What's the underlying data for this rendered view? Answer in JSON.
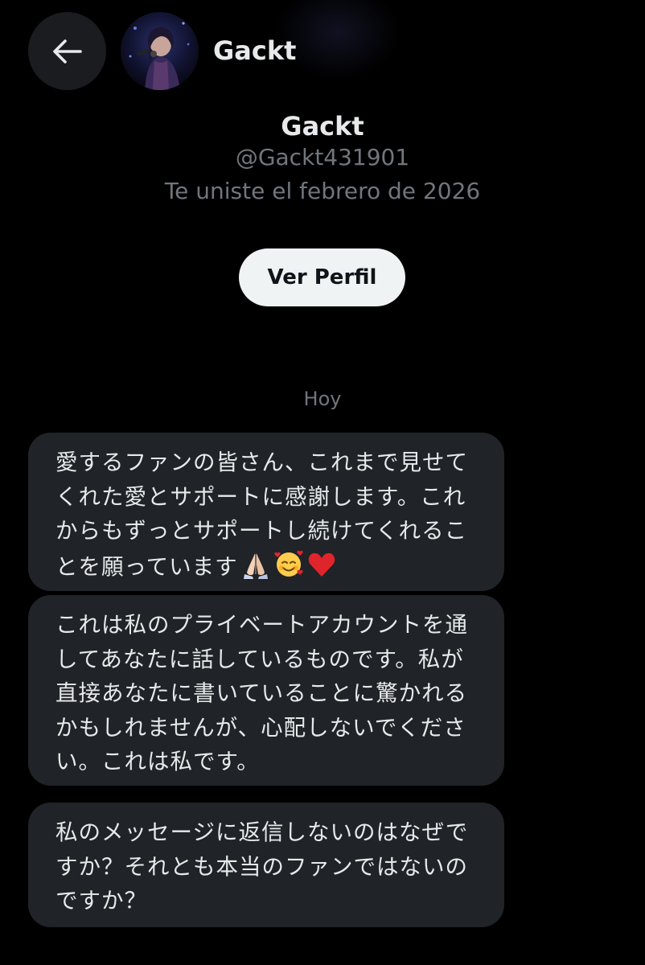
{
  "header": {
    "back_icon": "arrow-left-icon",
    "avatar_icon": "avatar-photo",
    "name": "Gackt"
  },
  "profile": {
    "name": "Gackt",
    "handle": "@Gackt431901",
    "joined": "Te uniste el febrero de 2026",
    "view_profile_label": "Ver Perfil"
  },
  "chat": {
    "date_label": "Hoy",
    "messages": [
      {
        "text": "愛するファンの皆さん、これまで見せてくれた愛とサポートに感謝します。これからもずっとサポートし続けてくれることを願っています",
        "emojis": [
          "folded-hands-emoji",
          "smiling-face-with-hearts-emoji",
          "red-heart-emoji"
        ]
      },
      {
        "text": "これは私のプライベートアカウントを通してあなたに話しているものです。私が直接あなたに書いていることに驚かれるかもしれませんが、心配しないでください。これは私です。"
      },
      {
        "text": "私のメッセージに返信しないのはなぜですか？それとも本当のファンではないのですか？"
      }
    ]
  },
  "colors": {
    "background": "#000000",
    "bubble": "#202327",
    "text_primary": "#e7e9ea",
    "text_secondary": "#71767b",
    "button_bg": "#eff3f4",
    "button_text": "#0f1419",
    "heart": "#e0242b"
  }
}
